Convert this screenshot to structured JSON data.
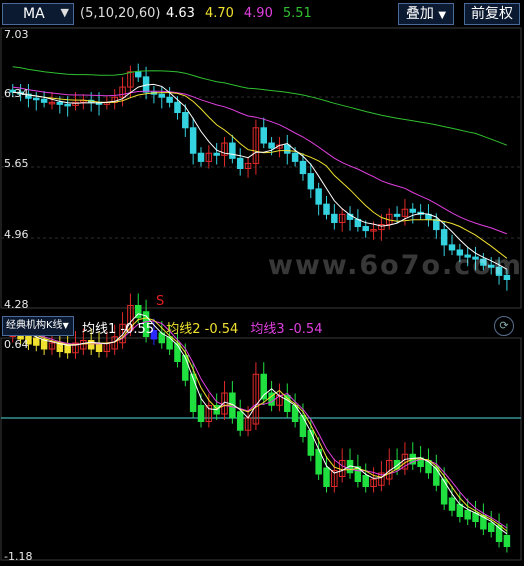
{
  "header": {
    "ma_select": "MA",
    "ma_params": "(5,10,20,60)",
    "ma_values": [
      {
        "value": "4.63",
        "color": "#ffffff"
      },
      {
        "value": "4.70",
        "color": "#f0e030"
      },
      {
        "value": "4.90",
        "color": "#e040e0"
      },
      {
        "value": "5.51",
        "color": "#30c030"
      }
    ],
    "overlay_button": "叠加",
    "adjust_button": "前复权"
  },
  "price_axis": [
    "7.03",
    "6.34",
    "5.65",
    "4.96",
    "4.28"
  ],
  "signal_marker": "S",
  "watermark": "www.6o7o.com",
  "indicator": {
    "select": "经典机构K线",
    "lines": [
      {
        "label": "均线1",
        "value": "-0.55",
        "color": "#ffffff"
      },
      {
        "label": "均线2",
        "value": "-0.54",
        "color": "#f0e030"
      },
      {
        "label": "均线3",
        "value": "-0.54",
        "color": "#e040e0"
      }
    ],
    "axis": [
      "0.64",
      "-1.18"
    ]
  },
  "chart_data": {
    "type": "candlestick",
    "ylim": [
      4.28,
      7.03
    ],
    "ma_colors": {
      "ma5": "#ffffff",
      "ma10": "#f0e030",
      "ma20": "#e040e0",
      "ma60": "#30c030"
    }
  }
}
